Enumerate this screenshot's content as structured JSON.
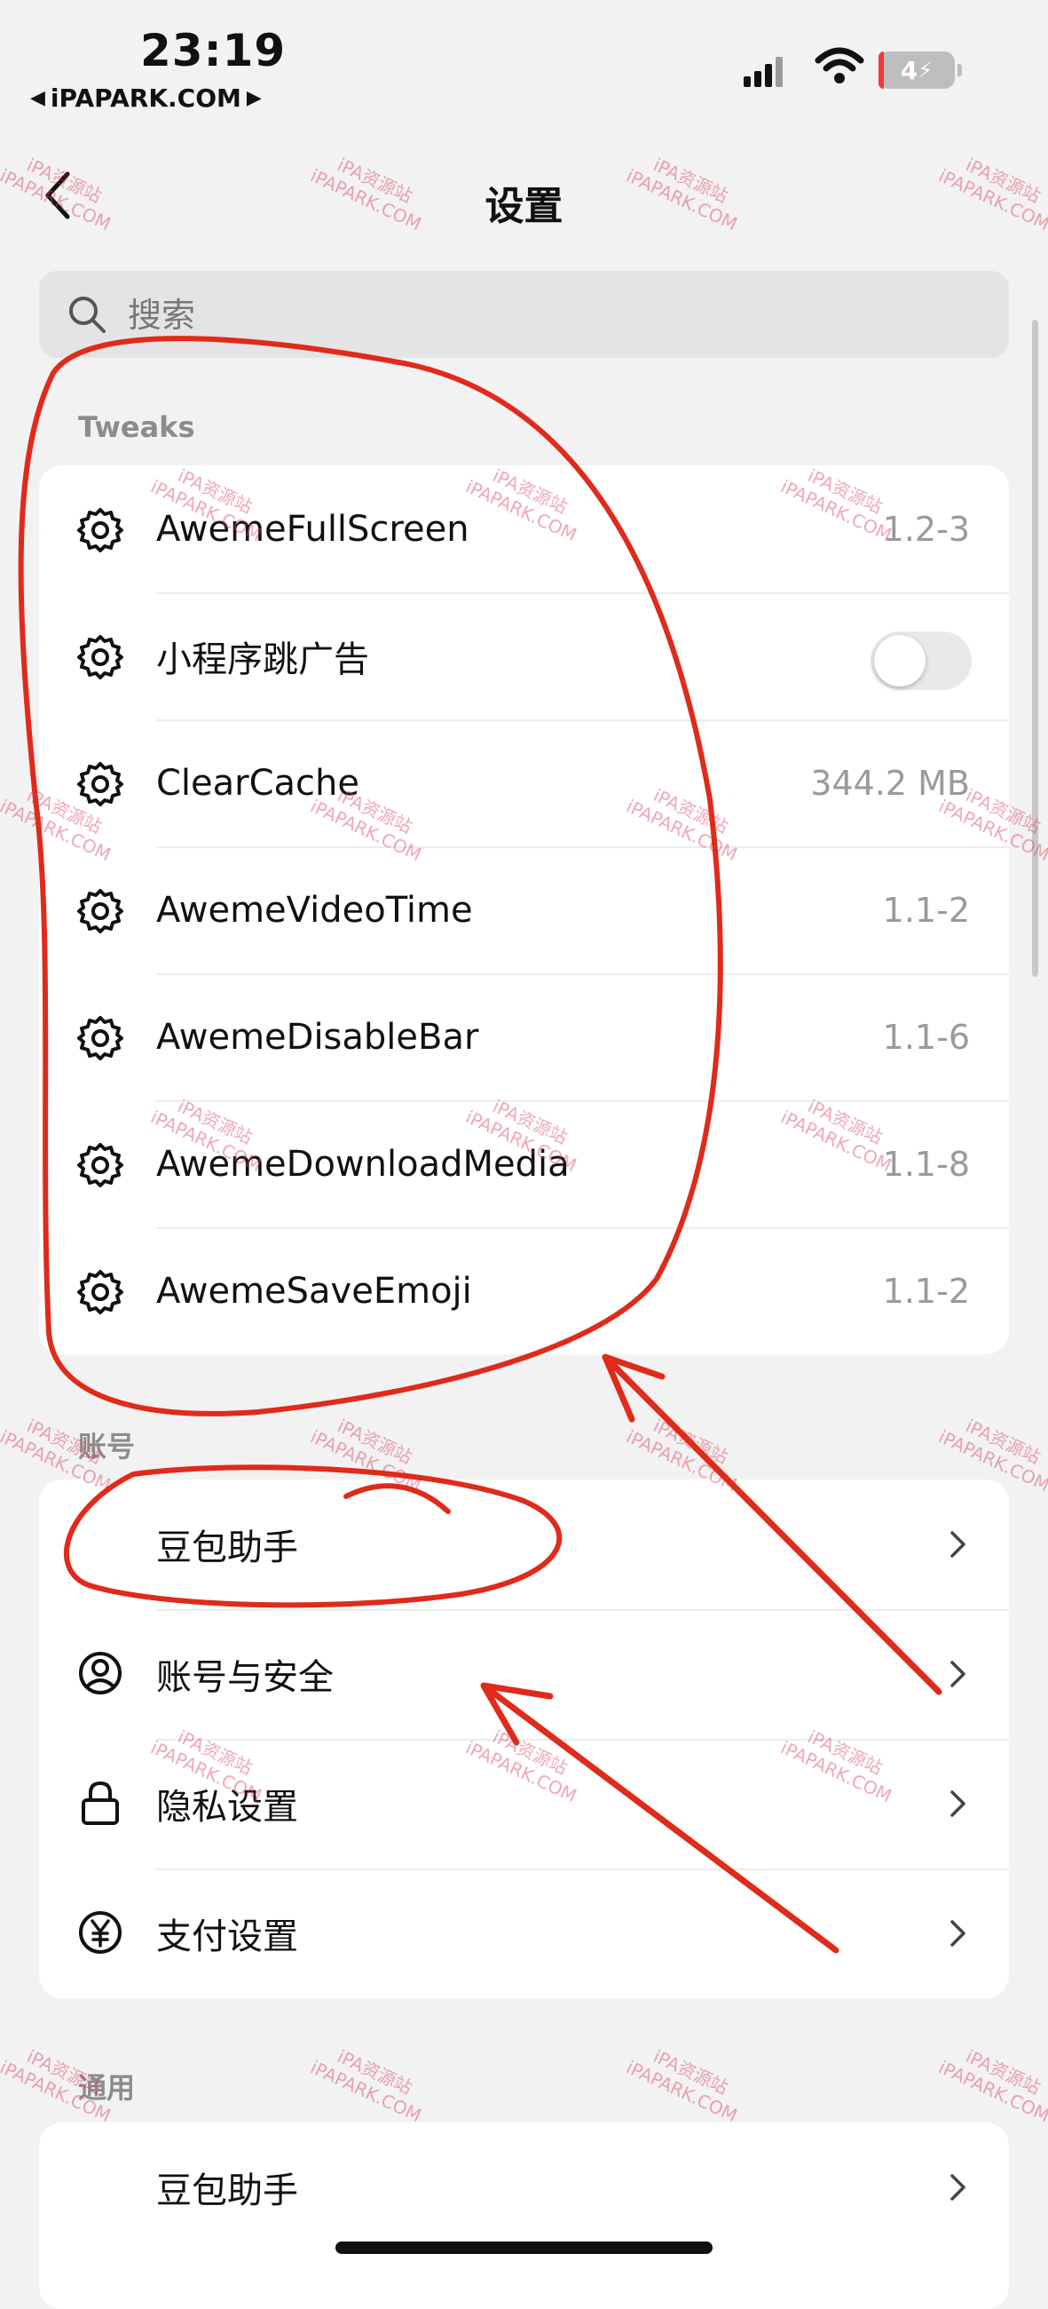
{
  "status_bar": {
    "time": "23:19",
    "carrier": "iPAPARK.COM",
    "battery": "4"
  },
  "nav": {
    "title": "设置"
  },
  "search": {
    "placeholder": "搜索"
  },
  "sections": {
    "tweaks": {
      "title": "Tweaks",
      "items": [
        {
          "label": "AwemeFullScreen",
          "value": "1.2-3"
        },
        {
          "label": "小程序跳广告",
          "toggle_on": false
        },
        {
          "label": "ClearCache",
          "value": "344.2 MB"
        },
        {
          "label": "AwemeVideoTime",
          "value": "1.1-2"
        },
        {
          "label": "AwemeDisableBar",
          "value": "1.1-6"
        },
        {
          "label": "AwemeDownloadMedia",
          "value": "1.1-8"
        },
        {
          "label": "AwemeSaveEmoji",
          "value": "1.1-2"
        }
      ]
    },
    "account": {
      "title": "账号",
      "items": [
        {
          "label": "豆包助手"
        },
        {
          "label": "账号与安全"
        },
        {
          "label": "隐私设置"
        },
        {
          "label": "支付设置"
        }
      ]
    },
    "general": {
      "title": "通用",
      "items": [
        {
          "label": "豆包助手"
        }
      ]
    }
  },
  "watermark": {
    "line1": "iPA资源站",
    "line2": "iPAPARK.COM"
  },
  "colors": {
    "background": "#f2f2f2",
    "card": "#ffffff",
    "annotation": "#e02a1a",
    "secondary_text": "#9a9a9a"
  }
}
